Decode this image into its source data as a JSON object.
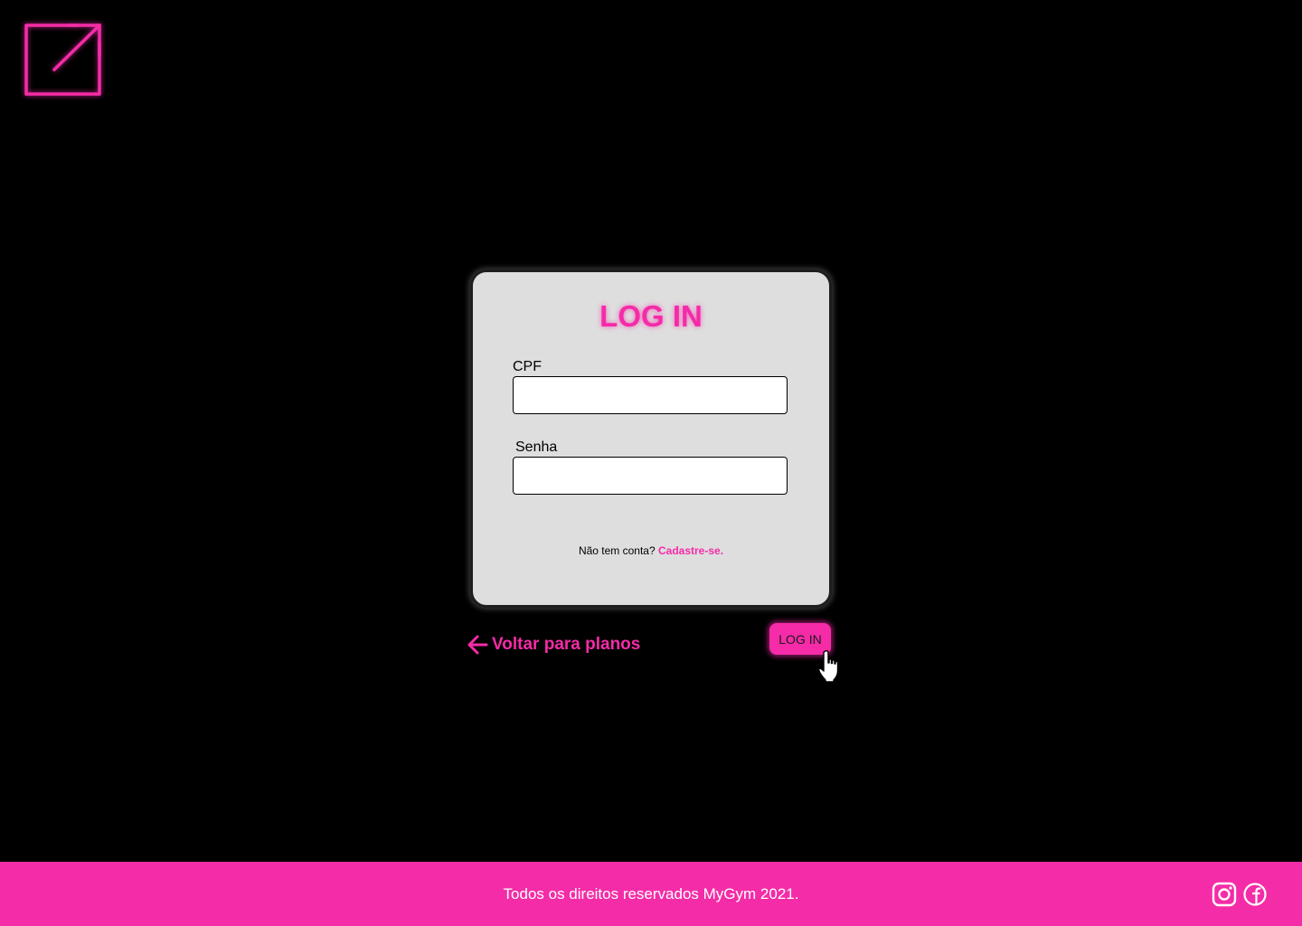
{
  "logo": {
    "icon": "external-link-icon",
    "color": "#f42ca7"
  },
  "login_card": {
    "title": "LOG IN",
    "cpf_label": "CPF",
    "cpf_value": "",
    "password_label": "Senha",
    "password_value": "",
    "signup_prompt": "Não tem conta?",
    "signup_link": "Cadastre-se."
  },
  "actions": {
    "back_label": "Voltar para planos",
    "back_icon": "arrow-left-icon",
    "login_button": "LOG IN",
    "cursor_icon": "hand-pointer-icon"
  },
  "footer": {
    "text": "Todos os direitos reservados MyGym 2021.",
    "social": [
      {
        "name": "instagram-icon"
      },
      {
        "name": "facebook-icon"
      }
    ]
  },
  "colors": {
    "accent": "#f42ca7",
    "background": "#000000",
    "card": "#dedede"
  }
}
